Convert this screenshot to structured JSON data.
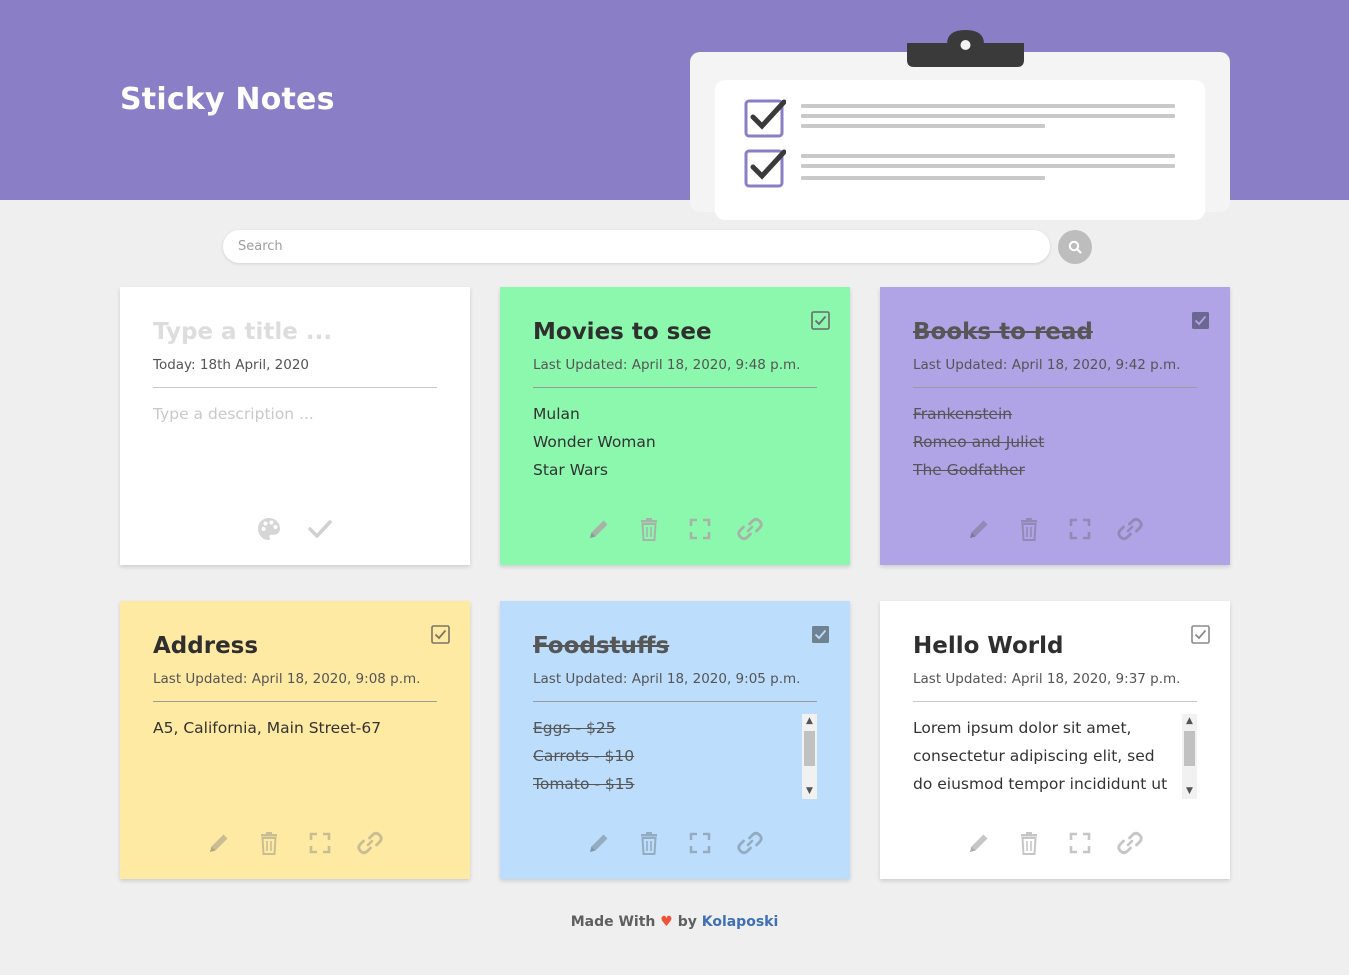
{
  "app": {
    "title": "Sticky Notes"
  },
  "search": {
    "placeholder": "Search"
  },
  "new_note": {
    "title_placeholder": "Type a title ...",
    "date": "Today: 18th April, 2020",
    "description_placeholder": "Type a description ..."
  },
  "notes": [
    {
      "title": "Movies to see",
      "updated": "Last Updated: April 18, 2020, 9:48 p.m.",
      "items": [
        "Mulan",
        "Wonder Woman",
        "Star Wars"
      ],
      "completed": false,
      "color": "#8cf8ad"
    },
    {
      "title": "Books to read",
      "updated": "Last Updated: April 18, 2020, 9:42 p.m.",
      "items": [
        "Frankenstein",
        "Romeo and Juliet",
        "The Godfather"
      ],
      "completed": true,
      "color": "#b0a4e6"
    },
    {
      "title": "Address",
      "updated": "Last Updated: April 18, 2020, 9:08 p.m.",
      "items": [
        "A5, California, Main Street-67"
      ],
      "completed": false,
      "color": "#ffeaa4"
    },
    {
      "title": "Foodstuffs",
      "updated": "Last Updated: April 18, 2020, 9:05 p.m.",
      "items": [
        "Eggs - $25",
        "Carrots - $10",
        "Tomato - $15"
      ],
      "completed": true,
      "color": "#bcdefc"
    },
    {
      "title": "Hello World",
      "updated": "Last Updated: April 18, 2020, 9:37 p.m.",
      "items": [
        "Lorem ipsum dolor sit amet,",
        "consectetur adipiscing elit, sed",
        "do eiusmod tempor incididunt ut"
      ],
      "completed": false,
      "color": "#ffffff"
    }
  ],
  "footer": {
    "made_with": "Made With",
    "heart": "♥",
    "by": "by",
    "author": "Kolaposki"
  },
  "icons": [
    "palette-icon",
    "check-icon",
    "pencil-icon",
    "trash-icon",
    "expand-icon",
    "link-icon",
    "checkbox-icon",
    "search-icon"
  ]
}
